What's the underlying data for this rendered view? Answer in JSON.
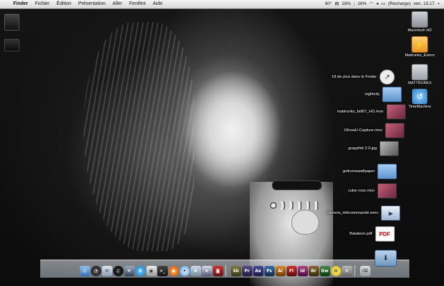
{
  "menubar": {
    "apple": "",
    "app": "Finder",
    "items": [
      "Fichier",
      "Édition",
      "Présentation",
      "Aller",
      "Fenêtre",
      "Aide"
    ],
    "status": {
      "temp": "60°",
      "cpu": "16%",
      "cpu2": "16%",
      "battery": "(Recharge)",
      "clock": "ven. 15:17"
    }
  },
  "desktop_icons": [
    {
      "label": "Macintosh HD",
      "icon": "hard-drive-icon"
    },
    {
      "label": "Mattrunks_Extern",
      "icon": "external-drive-icon"
    },
    {
      "label": "MATTRUNKS",
      "icon": "usb-drive-icon"
    },
    {
      "label": "TimeMachine",
      "icon": "time-machine-icon"
    }
  ],
  "stack": {
    "more_label": "18 de plus dans le Finder",
    "items": [
      {
        "label": "nightcity",
        "type": "folder"
      },
      {
        "label": "mattrunks_fall07_HD.mov",
        "type": "movie"
      },
      {
        "label": "iShowU-Capture.mov",
        "type": "movie"
      },
      {
        "label": "grapphiti 2.0.jpg",
        "type": "photo"
      },
      {
        "label": "goticonswallpaper",
        "type": "folder"
      },
      {
        "label": "cube rose.mov",
        "type": "movie"
      },
      {
        "label": "Camera_télécommandé.wmv",
        "type": "wmv"
      },
      {
        "label": "Bataleon.pdf",
        "type": "pdf"
      }
    ]
  },
  "dock": {
    "apps": [
      "Finder",
      "Dashboard",
      "Mail",
      "iTunes",
      "Xcode",
      "Skype",
      "Preview",
      "Terminal",
      "Firefox",
      "Safari",
      "iPhoto",
      "iMovie",
      "Photo Booth",
      "Soundbooth",
      "Premiere",
      "After Effects",
      "Photoshop",
      "Illustrator",
      "Flash",
      "InDesign",
      "Bridge",
      "Dreamweaver",
      "Adium",
      "Automator"
    ],
    "adobe_badges": [
      "Sb",
      "Pr",
      "Ae",
      "Ps",
      "Ai",
      "Fl",
      "Id",
      "Br",
      "Dw"
    ]
  },
  "colors": {
    "menubar_bg": "#e6e6e6",
    "folder_blue": "#6fa3da",
    "pdf_red": "#cc0000"
  }
}
